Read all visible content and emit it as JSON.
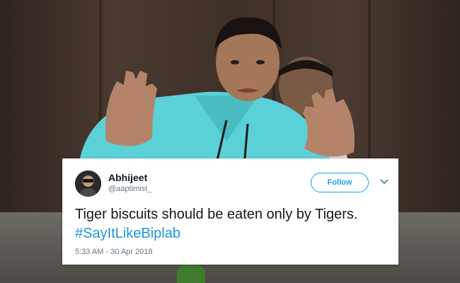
{
  "tweet": {
    "user_name": "Abhijeet",
    "handle": "@aaptimist_",
    "follow_label": "Follow",
    "text_main": "Tiger biscuits should be eaten only by Tigers.",
    "hashtag": "#SayItLikeBiplab",
    "timestamp": "5:33 AM - 30 Apr 2018",
    "accent_color": "#1da1f2",
    "more_icon": "chevron-down-icon",
    "avatar_icon": "user-avatar-icon"
  }
}
